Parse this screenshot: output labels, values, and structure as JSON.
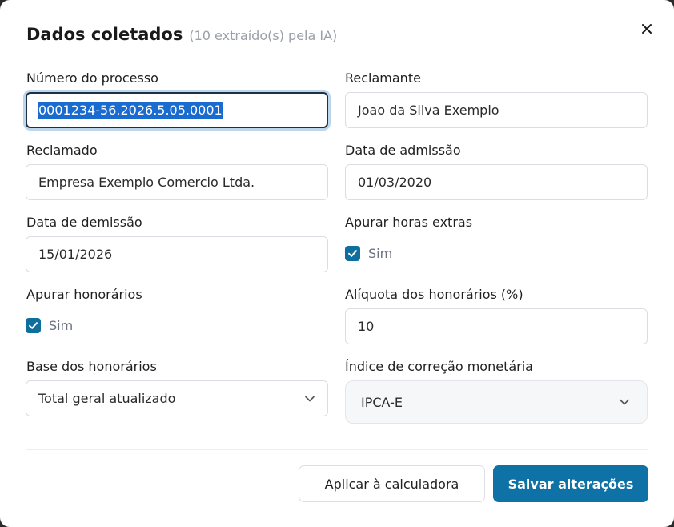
{
  "dialog": {
    "title": "Dados coletados",
    "subtitle": "(10 extraído(s) pela IA)",
    "close_icon": "close-icon"
  },
  "fields": {
    "numero_processo": {
      "label": "Número do processo",
      "value": "0001234-56.2026.5.05.0001"
    },
    "reclamante": {
      "label": "Reclamante",
      "value": "Joao da Silva Exemplo"
    },
    "reclamado": {
      "label": "Reclamado",
      "value": "Empresa Exemplo Comercio Ltda."
    },
    "data_admissao": {
      "label": "Data de admissão",
      "value": "01/03/2020"
    },
    "data_demissao": {
      "label": "Data de demissão",
      "value": "15/01/2026"
    },
    "apurar_horas_extras": {
      "label": "Apurar horas extras",
      "checkbox_label": "Sim",
      "checked": true
    },
    "apurar_honorarios": {
      "label": "Apurar honorários",
      "checkbox_label": "Sim",
      "checked": true
    },
    "aliquota_honorarios": {
      "label": "Alíquota dos honorários (%)",
      "value": "10"
    },
    "base_honorarios": {
      "label": "Base dos honorários",
      "selected": "Total geral atualizado"
    },
    "indice_correcao": {
      "label": "Índice de correção monetária",
      "selected": "IPCA-E"
    }
  },
  "footer": {
    "apply_label": "Aplicar à calculadora",
    "save_label": "Salvar alterações"
  },
  "colors": {
    "primary": "#0e72a6",
    "checkbox": "#0e6f9e",
    "selection": "#1a6bd0"
  }
}
